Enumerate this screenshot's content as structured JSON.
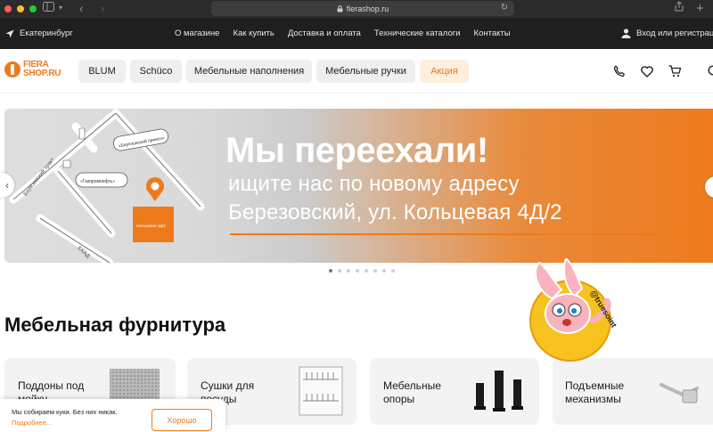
{
  "browser": {
    "url": "fierashop.ru",
    "lock_icon": "lock-icon",
    "share_icon": "share-icon",
    "new_tab_icon": "plus-icon"
  },
  "topnav": {
    "city": "Екатеринбург",
    "links": [
      "О магазине",
      "Как купить",
      "Доставка и оплата",
      "Технические каталоги",
      "Контакты"
    ],
    "login": "Вход или регистрац"
  },
  "header": {
    "logo": {
      "line1": "FIERA",
      "line2": "SHOP.RU"
    },
    "categories": [
      "BLUM",
      "Schüco",
      "Мебельные наполнения",
      "Мебельные ручки"
    ],
    "promo": "Акция",
    "accent": "#ee7a1b"
  },
  "banner": {
    "headline": "Мы переехали!",
    "sub1": "ищите нас по новому адресу",
    "sub2": "Березовский, ул. Кольцевая 4Д/2",
    "map_labels": {
      "road1": "Берёзовский тракт",
      "road2": "ЕКАД",
      "place1": "«Берёзовский приисп»",
      "place2": "«Газпромнефть»",
      "pin_label": "Кольцевая 4Д/2"
    },
    "slides_total": 8,
    "slide_active": 1
  },
  "section": {
    "title": "Мебельная фурнитура",
    "cards": [
      {
        "label": "Поддоны под мойку"
      },
      {
        "label": "Сушки для посуды"
      },
      {
        "label": "Мебельные опоры"
      },
      {
        "label": "Подъемные механизмы"
      }
    ]
  },
  "sticker": {
    "handle": "@truesoint"
  },
  "cookie": {
    "message": "Мы собираем куки. Без них никак.",
    "more": "Подробнее...",
    "button": "Хорошо"
  }
}
